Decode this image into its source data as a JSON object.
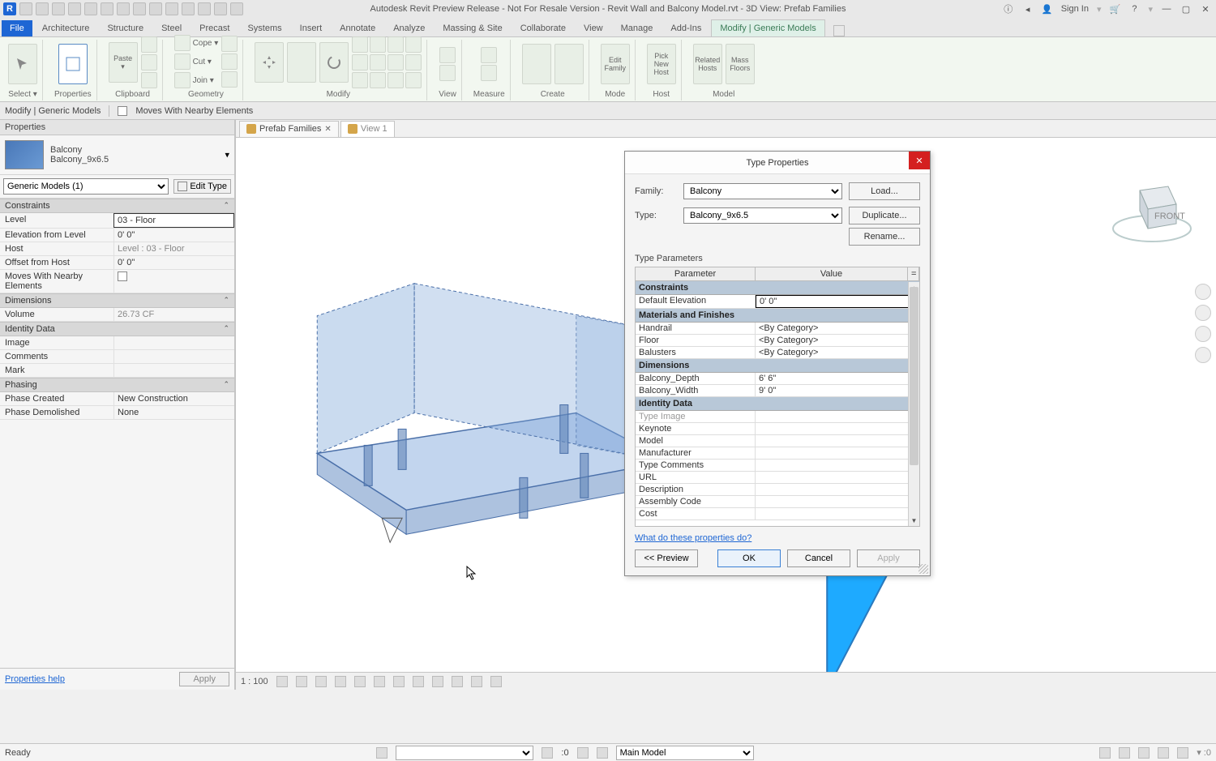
{
  "titlebar": {
    "app_title": "Autodesk Revit Preview Release - Not For Resale Version - Revit Wall and Balcony Model.rvt - 3D View: Prefab Families",
    "signin": "Sign In"
  },
  "ribbon": {
    "tabs": [
      "File",
      "Architecture",
      "Structure",
      "Steel",
      "Precast",
      "Systems",
      "Insert",
      "Annotate",
      "Analyze",
      "Massing & Site",
      "Collaborate",
      "View",
      "Manage",
      "Add-Ins",
      "Modify | Generic Models"
    ],
    "active_tab": "Modify | Generic Models",
    "groups": {
      "select": "Select ▾",
      "properties": "Properties",
      "clipboard": "Clipboard",
      "geometry": "Geometry",
      "modify": "Modify",
      "view": "View",
      "measure": "Measure",
      "create": "Create",
      "mode": "Mode",
      "host": "Host",
      "model": "Model"
    },
    "geom_cmds": {
      "cope": "Cope ▾",
      "cut": "Cut ▾",
      "join": "Join ▾"
    },
    "mode_cmd": {
      "edit_family": "Edit\nFamily"
    },
    "host_cmds": {
      "pick": "Pick\nNew Host"
    },
    "model_cmds": {
      "related": "Related\nHosts",
      "mass": "Mass\nFloors"
    },
    "clipboard_cmd": {
      "paste": "Paste\n▾"
    }
  },
  "optionsbar": {
    "context": "Modify | Generic Models",
    "moves_chk": "Moves With Nearby Elements"
  },
  "properties": {
    "title": "Properties",
    "family": "Balcony",
    "type": "Balcony_9x6.5",
    "instance_filter": "Generic Models (1)",
    "edit_type": "Edit Type",
    "groups": {
      "constraints": "Constraints",
      "dimensions": "Dimensions",
      "identity": "Identity Data",
      "phasing": "Phasing"
    },
    "rows": {
      "level": {
        "name": "Level",
        "value": "03 - Floor"
      },
      "elev": {
        "name": "Elevation from Level",
        "value": "0'  0\""
      },
      "host": {
        "name": "Host",
        "value": "Level : 03 - Floor"
      },
      "offset": {
        "name": "Offset from Host",
        "value": "0'  0\""
      },
      "moves": {
        "name": "Moves With Nearby Elements"
      },
      "volume": {
        "name": "Volume",
        "value": "26.73 CF"
      },
      "image": {
        "name": "Image",
        "value": ""
      },
      "comments": {
        "name": "Comments",
        "value": ""
      },
      "mark": {
        "name": "Mark",
        "value": ""
      },
      "phase_created": {
        "name": "Phase Created",
        "value": "New Construction"
      },
      "phase_demolished": {
        "name": "Phase Demolished",
        "value": "None"
      }
    },
    "help_link": "Properties help",
    "apply": "Apply"
  },
  "viewtabs": {
    "tab1": "Prefab Families",
    "tab2": "View 1"
  },
  "viewcontrols": {
    "scale": "1 : 100"
  },
  "dialog": {
    "title": "Type Properties",
    "family_lbl": "Family:",
    "family_val": "Balcony",
    "type_lbl": "Type:",
    "type_val": "Balcony_9x6.5",
    "load": "Load...",
    "duplicate": "Duplicate...",
    "rename": "Rename...",
    "type_params": "Type Parameters",
    "col_param": "Parameter",
    "col_value": "Value",
    "groups": {
      "constraints": "Constraints",
      "materials": "Materials and Finishes",
      "dimensions": "Dimensions",
      "identity": "Identity Data"
    },
    "rows": {
      "default_elev": {
        "name": "Default Elevation",
        "value": "0'  0\""
      },
      "handrail": {
        "name": "Handrail",
        "value": "<By Category>"
      },
      "floor": {
        "name": "Floor",
        "value": "<By Category>"
      },
      "balusters": {
        "name": "Balusters",
        "value": "<By Category>"
      },
      "depth": {
        "name": "Balcony_Depth",
        "value": "6'  6\""
      },
      "width": {
        "name": "Balcony_Width",
        "value": "9'  0\""
      },
      "type_image": {
        "name": "Type Image",
        "value": ""
      },
      "keynote": {
        "name": "Keynote",
        "value": ""
      },
      "model": {
        "name": "Model",
        "value": ""
      },
      "manufacturer": {
        "name": "Manufacturer",
        "value": ""
      },
      "type_comments": {
        "name": "Type Comments",
        "value": ""
      },
      "url": {
        "name": "URL",
        "value": ""
      },
      "description": {
        "name": "Description",
        "value": ""
      },
      "assembly": {
        "name": "Assembly Code",
        "value": ""
      },
      "cost": {
        "name": "Cost",
        "value": ""
      }
    },
    "help_link": "What do these properties do?",
    "preview": "<< Preview",
    "ok": "OK",
    "cancel": "Cancel",
    "apply": "Apply"
  },
  "statusbar": {
    "ready": "Ready",
    "main_model": "Main Model",
    "zero": ":0"
  }
}
